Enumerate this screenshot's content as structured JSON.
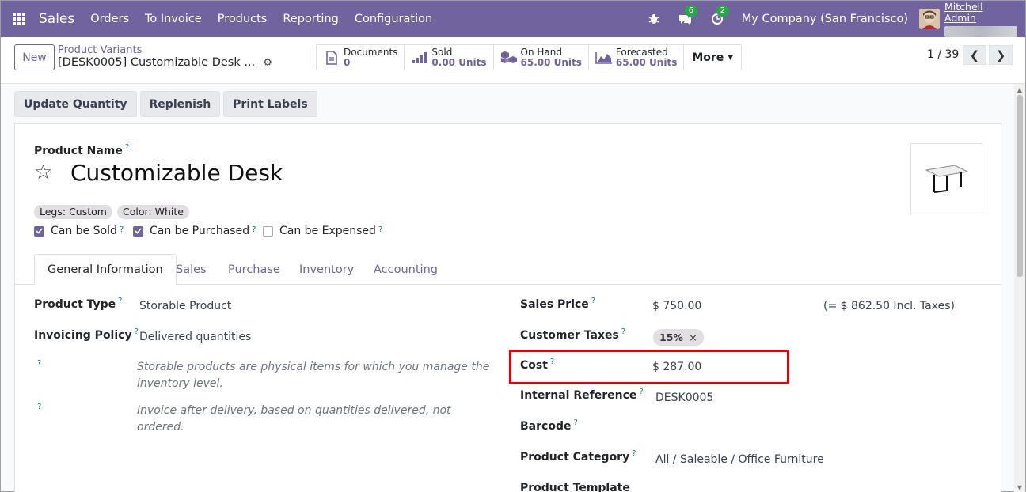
{
  "navbar": {
    "app_name": "Sales",
    "menu": [
      "Orders",
      "To Invoice",
      "Products",
      "Reporting",
      "Configuration"
    ],
    "activity_badge": "6",
    "messages_badge": "2",
    "company": "My Company (San Francisco)",
    "user_name": "Mitchell Admin"
  },
  "control": {
    "new_label": "New",
    "breadcrumb": "Product Variants",
    "record_title": "[DESK0005] Customizable Desk ...",
    "smart_buttons": [
      {
        "label": "Documents",
        "value": "0",
        "icon": "documents-icon"
      },
      {
        "label": "Sold",
        "value": "0.00 Units",
        "icon": "bar-chart-icon"
      },
      {
        "label": "On Hand",
        "value": "65.00 Units",
        "icon": "cubes-icon"
      },
      {
        "label": "Forecasted",
        "value": "65.00 Units",
        "icon": "area-chart-icon"
      }
    ],
    "more_label": "More",
    "pager": "1 / 39"
  },
  "actions": [
    "Update Quantity",
    "Replenish",
    "Print Labels"
  ],
  "form": {
    "product_name_label": "Product Name",
    "product_name": "Customizable Desk",
    "tags": [
      "Legs: Custom",
      "Color: White"
    ],
    "checkboxes": [
      {
        "label": "Can be Sold",
        "checked": true
      },
      {
        "label": "Can be Purchased",
        "checked": true
      },
      {
        "label": "Can be Expensed",
        "checked": false
      }
    ],
    "tabs": [
      "General Information",
      "Sales",
      "Purchase",
      "Inventory",
      "Accounting"
    ],
    "left": {
      "product_type_label": "Product Type",
      "product_type": "Storable Product",
      "invoicing_policy_label": "Invoicing Policy",
      "invoicing_policy": "Delivered quantities",
      "hint_storable": "Storable products are physical items for which you manage the inventory level.",
      "hint_invoice": "Invoice after delivery, based on quantities delivered, not ordered."
    },
    "right": {
      "sales_price_label": "Sales Price",
      "sales_price": "$ 750.00",
      "incl_taxes": "(= $ 862.50 Incl. Taxes)",
      "customer_taxes_label": "Customer Taxes",
      "customer_tax": "15%",
      "cost_label": "Cost",
      "cost": "$ 287.00",
      "internal_ref_label": "Internal Reference",
      "internal_ref": "DESK0005",
      "barcode_label": "Barcode",
      "product_category_label": "Product Category",
      "product_category": "All / Saleable / Office Furniture",
      "product_template_label": "Product Template"
    }
  },
  "colors": {
    "brand": "#71639e",
    "highlight": "#e00000",
    "badge": "#28a745"
  }
}
